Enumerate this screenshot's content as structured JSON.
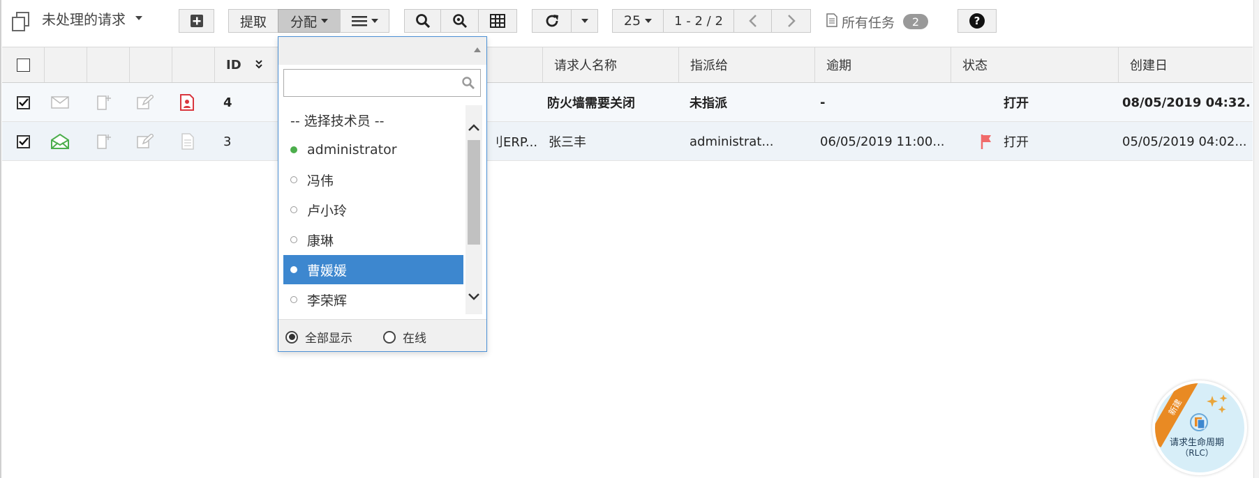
{
  "toolbar": {
    "view_title": "未处理的请求",
    "fetch_label": "提取",
    "assign_label": "分配",
    "page_size": "25",
    "page_range": "1 - 2 / 2",
    "all_tasks_label": "所有任务",
    "all_tasks_count": "2",
    "help_label": "?"
  },
  "table": {
    "headers": {
      "id": "ID",
      "requester_name": "请求人名称",
      "assigned_to": "指派给",
      "overdue": "逾期",
      "status": "状态",
      "created": "创建日"
    },
    "rows": [
      {
        "id": "4",
        "subject_tail": "",
        "requester": "防火墙需要关闭",
        "assigned": "未指派",
        "overdue": "-",
        "status": "打开",
        "created": "08/05/2019 04:32...",
        "bold": true
      },
      {
        "id": "3",
        "subject_tail": "刂ERP...",
        "requester": "张三丰",
        "assigned": "administrat...",
        "overdue": "06/05/2019 11:00...",
        "status": "打开",
        "created": "05/05/2019 04:02...",
        "bold": false
      }
    ]
  },
  "assign_dropdown": {
    "search_placeholder": "",
    "items": [
      {
        "label": "-- 选择技术员 --",
        "dot": "none"
      },
      {
        "label": "administrator",
        "dot": "online"
      },
      {
        "label": "冯伟",
        "dot": "offline"
      },
      {
        "label": "卢小玲",
        "dot": "offline"
      },
      {
        "label": "康琳",
        "dot": "offline"
      },
      {
        "label": "曹媛媛",
        "dot": "offline",
        "selected": true
      },
      {
        "label": "李荣辉",
        "dot": "offline"
      }
    ],
    "filter_all": "全部显示",
    "filter_online": "在线"
  },
  "badge": {
    "ribbon": "新建",
    "line1": "请求生命周期",
    "line2": "（RLC）"
  },
  "colors": {
    "selected_bg": "#3d87cf",
    "online_dot": "#4cae4c",
    "flag": "#f06a6a",
    "pdf_icon": "#d9363e"
  }
}
